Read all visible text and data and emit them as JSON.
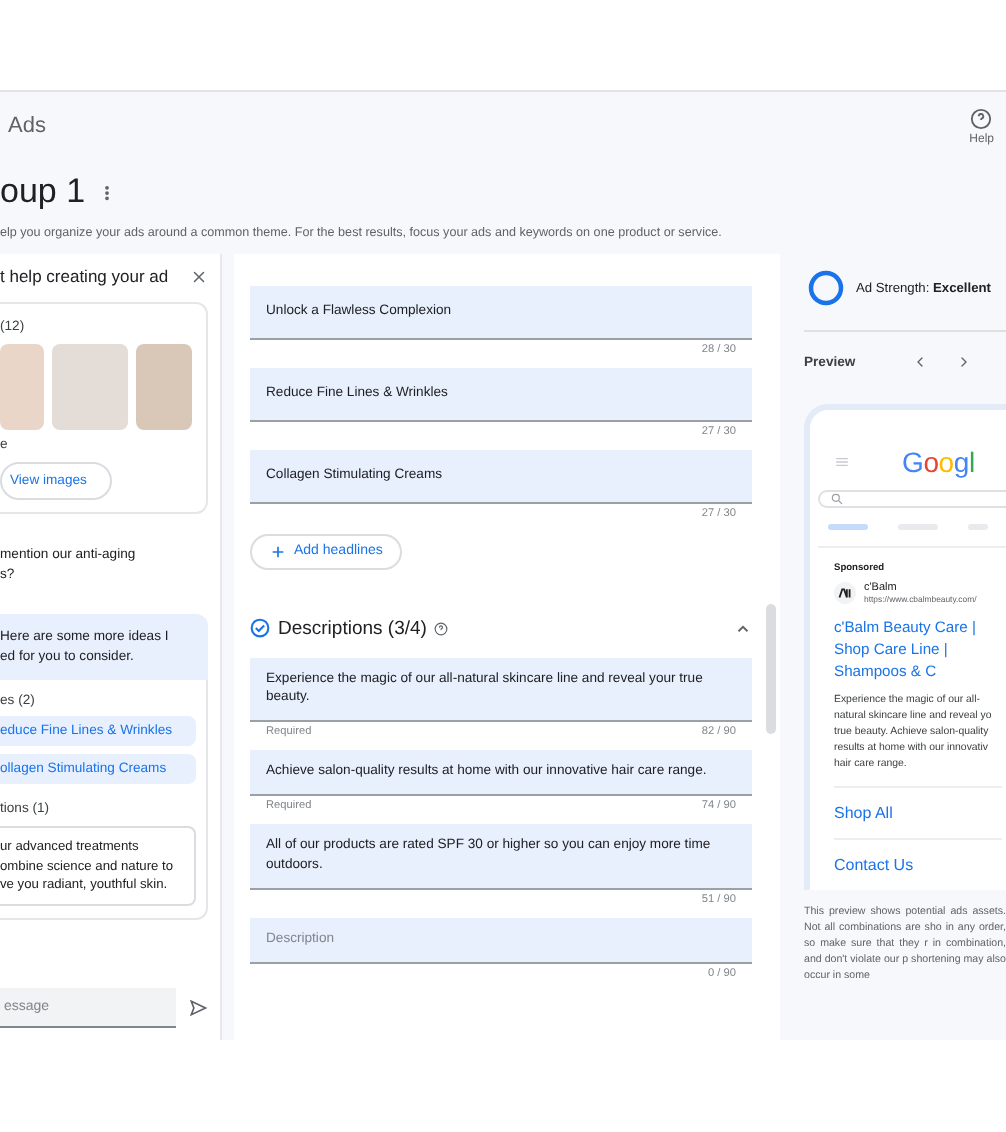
{
  "header": {
    "product": "Ads",
    "help": "Help"
  },
  "title": "oup 1",
  "subtitle": "elp you organize your ads around a common theme. For the best results, focus your ads and keywords on one product or service.",
  "assistant": {
    "title": "t help creating your ad",
    "images_label": "(12)",
    "image_caption": "e",
    "view_button": "View images",
    "user_message": "mention our anti-aging\ns?",
    "reply": "Here are some more ideas I\ned for you to consider.",
    "headlines_label": "es (2)",
    "headline_chips": [
      "educe Fine Lines & Wrinkles",
      "ollagen Stimulating Creams"
    ],
    "descriptions_label": "tions (1)",
    "description_suggestion": "ur advanced treatments\nombine science and nature to\nve you radiant, youthful skin.",
    "message_placeholder": "essage"
  },
  "headlines": [
    {
      "text": "Unlock a Flawless Complexion",
      "count": "28 / 30"
    },
    {
      "text": "Reduce Fine Lines & Wrinkles",
      "count": "27 / 30"
    },
    {
      "text": "Collagen Stimulating Creams",
      "count": "27 / 30"
    }
  ],
  "add_headlines": "Add headlines",
  "descriptions": {
    "title": "Descriptions (3/4)",
    "expanded": true,
    "items": [
      {
        "text": "Experience the magic of our all-natural skincare line and reveal your true beauty.",
        "note": "Required",
        "count": "82 / 90"
      },
      {
        "text": "Achieve salon-quality results at home with our innovative hair care range.",
        "note": "Required",
        "count": "74 / 90"
      },
      {
        "text": "All of our products are rated SPF 30 or higher so you can enjoy more time outdoors.",
        "count": "51 / 90"
      },
      {
        "placeholder": "Description",
        "count": "0 / 90"
      }
    ]
  },
  "ad_strength": {
    "label": "Ad Strength:",
    "value": "Excellent"
  },
  "preview": {
    "title": "Preview",
    "logo": "Googl",
    "sponsored": "Sponsored",
    "advertiser": "c'Balm",
    "url": "https://www.cbalmbeauty.com/",
    "headline": "c'Balm Beauty Care | Shop Care Line | Shampoos & C",
    "description": "Experience the magic of our all-natural skincare line and reveal yo true beauty. Achieve salon-quality results at home with our innovativ hair care range.",
    "links": [
      "Shop All",
      "Contact Us"
    ],
    "disclaimer": "This preview shows potential ads assets. Not all combinations are sho in any order, so make sure that they r in combination, and don't violate our p shortening may also occur in some"
  }
}
